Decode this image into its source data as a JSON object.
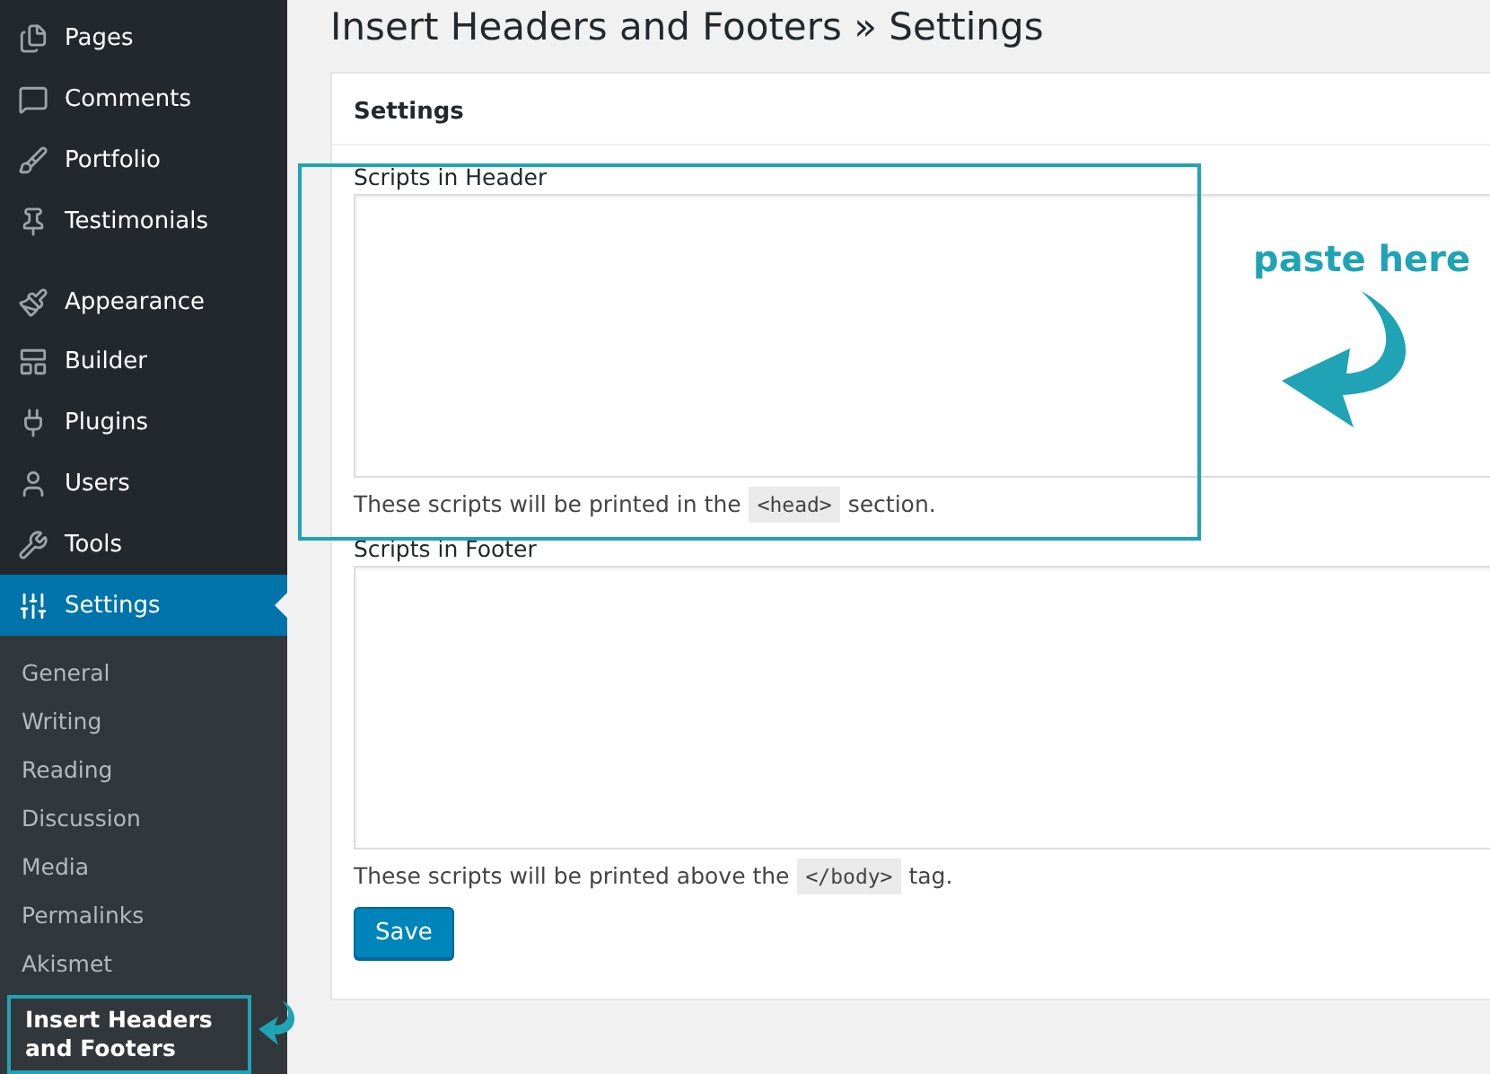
{
  "sidebar": {
    "menu": [
      {
        "label": "Pages",
        "selected": false,
        "group_start": false
      },
      {
        "label": "Comments",
        "selected": false,
        "group_start": false
      },
      {
        "label": "Portfolio",
        "selected": false,
        "group_start": false
      },
      {
        "label": "Testimonials",
        "selected": false,
        "group_start": false
      },
      {
        "label": "Appearance",
        "selected": false,
        "group_start": true
      },
      {
        "label": "Builder",
        "selected": false,
        "group_start": false
      },
      {
        "label": "Plugins",
        "selected": false,
        "group_start": false
      },
      {
        "label": "Users",
        "selected": false,
        "group_start": false
      },
      {
        "label": "Tools",
        "selected": false,
        "group_start": false
      },
      {
        "label": "Settings",
        "selected": true,
        "group_start": false
      }
    ],
    "submenu": [
      {
        "label": "General",
        "selected": false,
        "highlighted": false
      },
      {
        "label": "Writing",
        "selected": false,
        "highlighted": false
      },
      {
        "label": "Reading",
        "selected": false,
        "highlighted": false
      },
      {
        "label": "Discussion",
        "selected": false,
        "highlighted": false
      },
      {
        "label": "Media",
        "selected": false,
        "highlighted": false
      },
      {
        "label": "Permalinks",
        "selected": false,
        "highlighted": false
      },
      {
        "label": "Akismet",
        "selected": false,
        "highlighted": false
      },
      {
        "label": "Insert Headers and Footers",
        "selected": true,
        "highlighted": true
      }
    ]
  },
  "page_title": "Insert Headers and Footers » Settings",
  "card": {
    "title": "Settings",
    "fields": [
      {
        "label": "Scripts in Header",
        "highlighted": true,
        "description": {
          "before": "These scripts will be printed in the",
          "code": "<head>",
          "after": "section."
        }
      },
      {
        "label": "Scripts in Footer",
        "highlighted": false,
        "description": {
          "before": "These scripts will be printed above the",
          "code": "</body>",
          "after": "tag."
        }
      }
    ],
    "button": "Save"
  },
  "annotation": {
    "text": "paste here"
  }
}
